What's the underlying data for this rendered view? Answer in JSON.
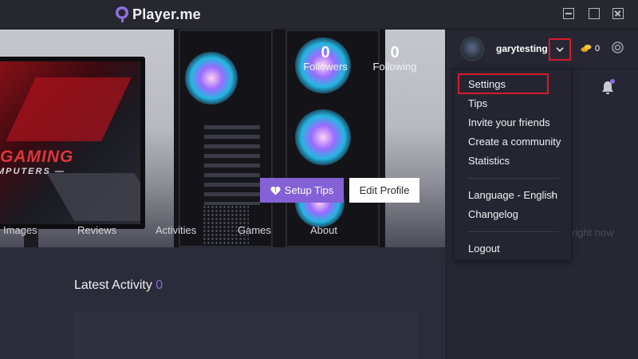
{
  "app": {
    "title": "Player.me"
  },
  "window_controls": {
    "minimize_icon": "minimize-icon",
    "maximize_icon": "maximize-icon",
    "close_icon": "close-icon"
  },
  "hero": {
    "monitor_text_line1": "GAMING",
    "monitor_text_line2": "MPUTERS —",
    "followers": {
      "count": "0",
      "label": "Followers"
    },
    "following": {
      "count": "0",
      "label": "Following"
    },
    "setup_tips_label": "Setup Tips",
    "edit_profile_label": "Edit Profile"
  },
  "tabs": [
    {
      "label": "Images"
    },
    {
      "label": "Reviews"
    },
    {
      "label": "Activities"
    },
    {
      "label": "Games"
    },
    {
      "label": "About"
    }
  ],
  "main": {
    "latest_activity_label": "Latest Activity",
    "latest_activity_count": "0"
  },
  "sidebar": {
    "username": "garytesting",
    "coins": "0",
    "ghost_text": "right now"
  },
  "dropdown": {
    "items": [
      {
        "label": "Settings"
      },
      {
        "label": "Tips"
      },
      {
        "label": "Invite your friends"
      },
      {
        "label": "Create a community"
      },
      {
        "label": "Statistics"
      },
      {
        "label": "Language - English"
      },
      {
        "label": "Changelog"
      },
      {
        "label": "Logout"
      }
    ]
  },
  "colors": {
    "accent": "#8461d6",
    "highlight_box": "#d7192b",
    "background": "#2a2b38",
    "sidebar": "#262733"
  }
}
